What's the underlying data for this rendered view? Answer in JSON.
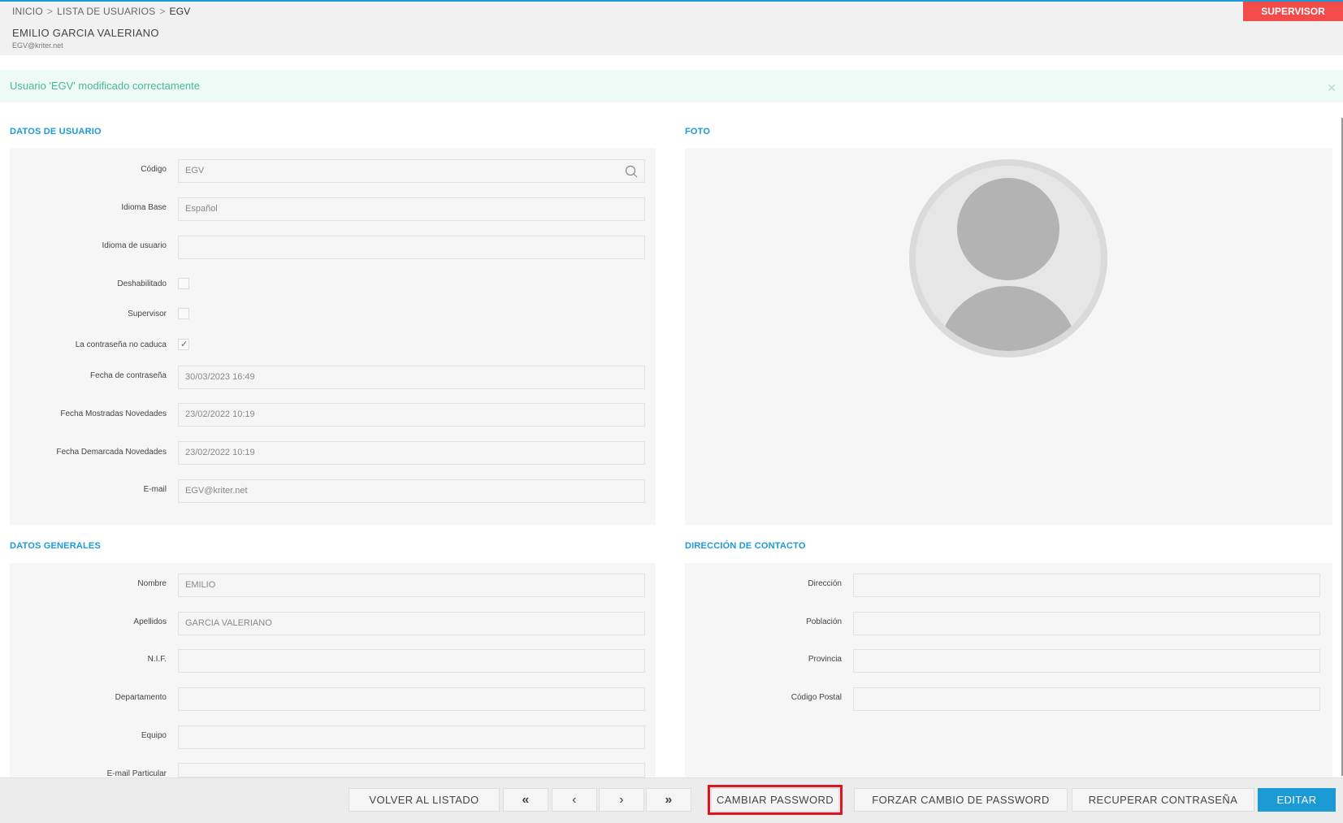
{
  "header": {
    "breadcrumb": [
      "INICIO",
      "LISTA DE USUARIOS",
      "EGV"
    ],
    "breadcrumb_separator": ">",
    "role_badge": "SUPERVISOR",
    "user_name": "EMILIO GARCIA VALERIANO",
    "user_email": "EGV@kriter.net"
  },
  "alert": {
    "message": "Usuario 'EGV' modificado correctamente",
    "close_icon": "close-icon"
  },
  "datos_usuario": {
    "title": "DATOS DE USUARIO",
    "codigo": {
      "label": "Código",
      "value": "EGV"
    },
    "idioma_base": {
      "label": "Idioma Base",
      "value": "Español"
    },
    "idioma_usuario": {
      "label": "Idioma de usuario",
      "value": ""
    },
    "deshabilitado": {
      "label": "Deshabilitado",
      "checked": false
    },
    "supervisor": {
      "label": "Supervisor",
      "checked": false
    },
    "no_caduca": {
      "label": "La contraseña no caduca",
      "checked": true,
      "tick": "✓"
    },
    "fecha_contrasena": {
      "label": "Fecha de contraseña",
      "value": "30/03/2023 16:49"
    },
    "fecha_mostradas": {
      "label": "Fecha Mostradas Novedades",
      "value": "23/02/2022 10:19"
    },
    "fecha_demarcada": {
      "label": "Fecha Demarcada Novedades",
      "value": "23/02/2022 10:19"
    },
    "email": {
      "label": "E-mail",
      "value": "EGV@kriter.net"
    }
  },
  "foto": {
    "title": "FOTO",
    "avatar_icon": "user-placeholder-icon"
  },
  "datos_generales": {
    "title": "DATOS GENERALES",
    "nombre": {
      "label": "Nombre",
      "value": "EMILIO"
    },
    "apellidos": {
      "label": "Apellidos",
      "value": "GARCIA VALERIANO"
    },
    "nif": {
      "label": "N.I.F.",
      "value": ""
    },
    "departamento": {
      "label": "Departamento",
      "value": ""
    },
    "equipo": {
      "label": "Equipo",
      "value": ""
    },
    "email_particular": {
      "label": "E-mail Particular",
      "value": ""
    }
  },
  "direccion_contacto": {
    "title": "DIRECCIÓN DE CONTACTO",
    "direccion": {
      "label": "Dirección",
      "value": ""
    },
    "poblacion": {
      "label": "Población",
      "value": ""
    },
    "provincia": {
      "label": "Provincia",
      "value": ""
    },
    "codigo_postal": {
      "label": "Código Postal",
      "value": ""
    }
  },
  "footer": {
    "volver": "VOLVER AL LISTADO",
    "first": "«",
    "prev": "‹",
    "next": "›",
    "last": "»",
    "cambiar_password": "CAMBIAR PASSWORD",
    "forzar_cambio": "FORZAR CAMBIO DE PASSWORD",
    "recuperar": "RECUPERAR CONTRASEÑA",
    "editar": "EDITAR"
  },
  "colors": {
    "accent": "#1b9ad6",
    "badge": "#f34a4a",
    "success": "#4ab78f",
    "highlight": "#e0141e"
  }
}
